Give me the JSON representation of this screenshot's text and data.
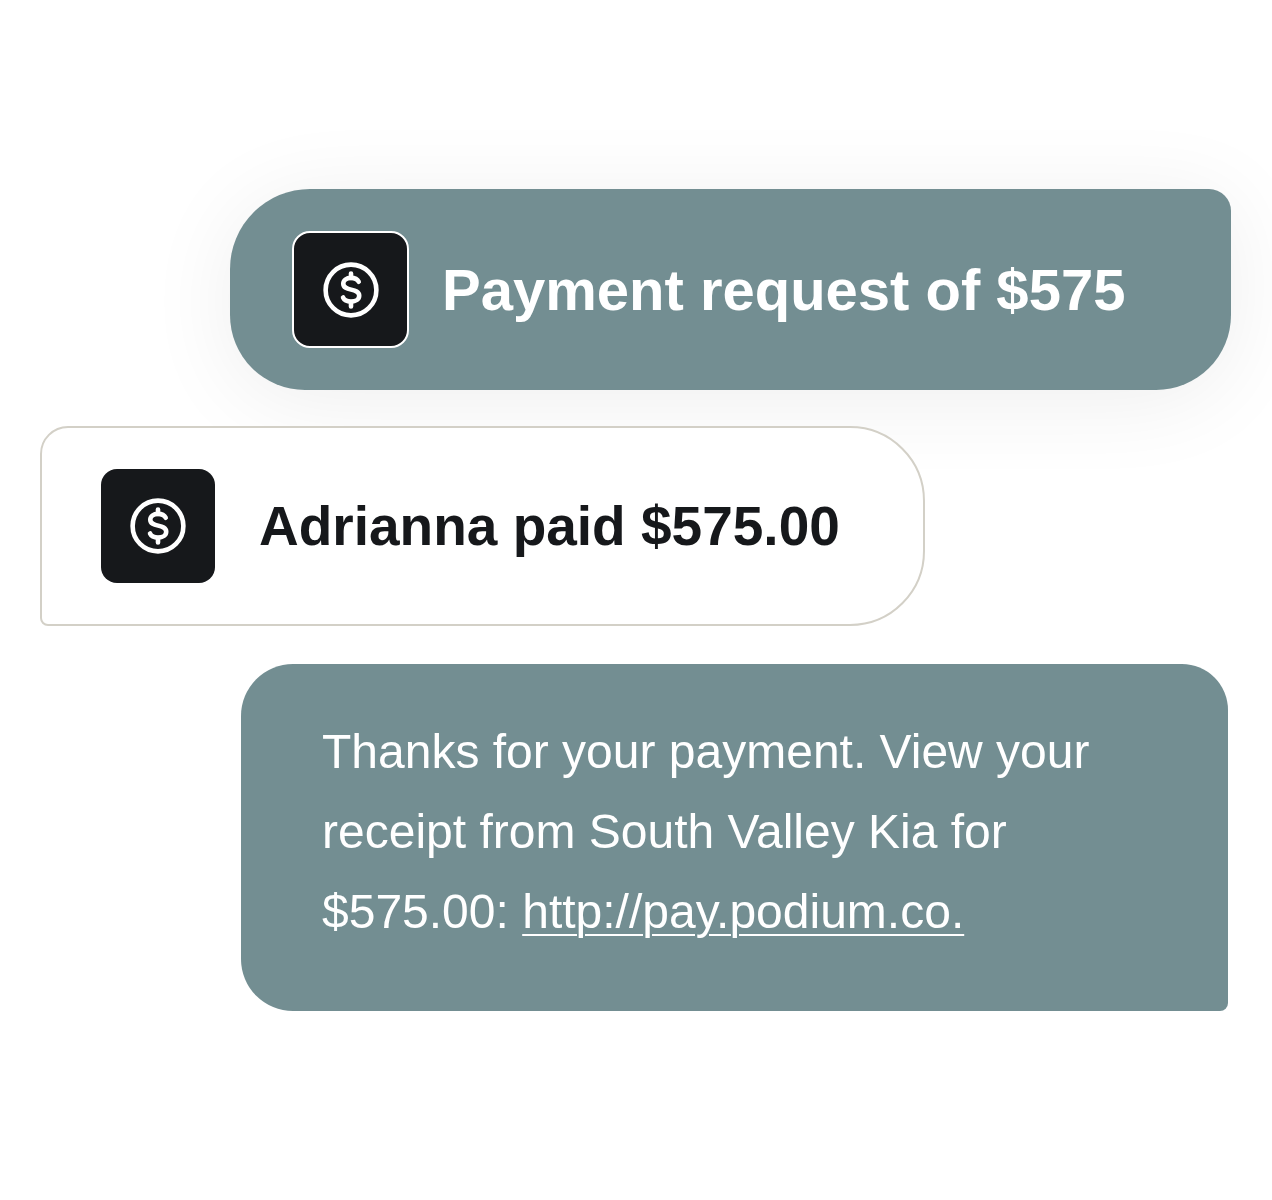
{
  "messages": [
    {
      "kind": "request",
      "text": "Payment request of $575"
    },
    {
      "kind": "paid",
      "text": "Adrianna paid $575.00"
    },
    {
      "kind": "receipt",
      "text": "Thanks for your payment. View your receipt from South Valley Kia for $575.00:",
      "link": "http://pay.podium.co."
    }
  ]
}
